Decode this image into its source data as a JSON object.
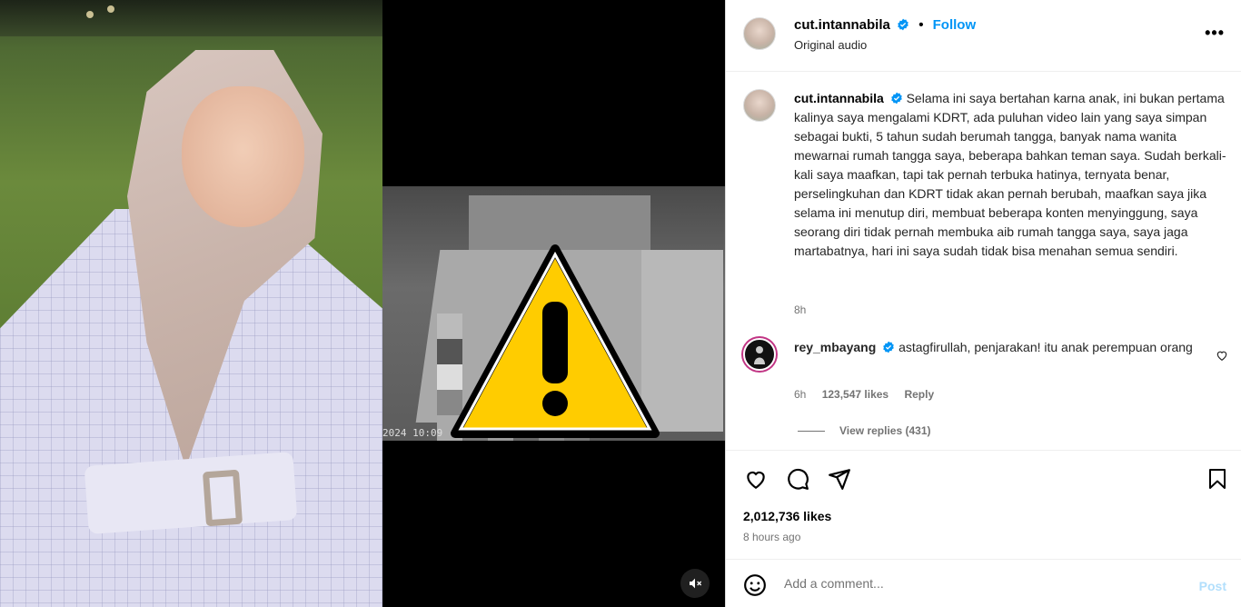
{
  "post": {
    "username": "cut.intannabila",
    "separator": "•",
    "follow_label": "Follow",
    "audio_label": "Original audio",
    "more_label": "•••"
  },
  "video": {
    "timestamp": "2024 10:09"
  },
  "caption": {
    "username": "cut.intannabila",
    "text": "Selama ini saya bertahan karna anak, ini bukan pertama kalinya saya mengalami KDRT, ada puluhan video lain yang saya simpan sebagai bukti, 5 tahun sudah berumah tangga, banyak nama wanita mewarnai rumah tangga saya, beberapa bahkan teman saya. Sudah berkali-kali saya maafkan, tapi tak pernah terbuka hatinya, ternyata benar, perselingkuhan dan KDRT tidak akan pernah berubah, maafkan saya jika selama ini menutup diri, membuat beberapa konten menyinggung, saya seorang diri tidak pernah membuka aib rumah tangga saya, saya jaga martabatnya, hari ini saya sudah tidak bisa menahan semua sendiri.",
    "time": "8h"
  },
  "comment": {
    "username": "rey_mbayang",
    "text": "astagfirullah, penjarakan! itu anak perempuan orang",
    "time": "6h",
    "likes": "123,547 likes",
    "reply_label": "Reply",
    "view_replies": "View replies (431)"
  },
  "stats": {
    "likes": "2,012,736 likes",
    "ago": "8 hours ago"
  },
  "composer": {
    "placeholder": "Add a comment...",
    "post_label": "Post"
  },
  "colors": {
    "accent": "#0095f6",
    "verified": "#0095f6",
    "warning_fill": "#ffcc00",
    "post_disabled": "#b2dffc"
  },
  "icons": {
    "like": "heart-icon",
    "comment": "comment-icon",
    "share": "paper-plane-icon",
    "save": "bookmark-icon",
    "emoji": "smiley-icon",
    "mute": "speaker-muted-icon",
    "more": "ellipsis-icon",
    "warning": "warning-triangle-icon"
  }
}
